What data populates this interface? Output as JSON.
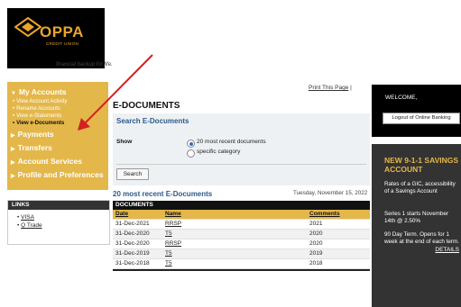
{
  "brand": {
    "name": "OPPA",
    "sub": "CREDIT UNION",
    "tagline": "financial backup for life."
  },
  "nav": {
    "my_accounts": "My Accounts",
    "sub_items": [
      "View Account Activity",
      "Rename Accounts",
      "View e-Statements",
      "View e-Documents"
    ],
    "payments": "Payments",
    "transfers": "Transfers",
    "account_services": "Account Services",
    "profile": "Profile and Preferences"
  },
  "links": {
    "title": "LINKS",
    "items": [
      "VISA",
      "Q Trade"
    ]
  },
  "main": {
    "print_link": "Print This Page",
    "title": "E-DOCUMENTS",
    "search_title": "Search E-Documents",
    "show_label": "Show",
    "option_recent": "20 most recent documents",
    "option_category": "specific category",
    "search_button": "Search",
    "recent_title": "20 most recent E-Documents",
    "date": "Tuesday, November 15, 2022"
  },
  "table": {
    "title": "DOCUMENTS",
    "headers": [
      "Date",
      "Name",
      "Comments"
    ],
    "rows": [
      [
        "31-Dec-2021",
        "RRSP",
        "2021"
      ],
      [
        "31-Dec-2020",
        "T5",
        "2020"
      ],
      [
        "31-Dec-2020",
        "RRSP",
        "2020"
      ],
      [
        "31-Dec-2019",
        "T5",
        "2019"
      ],
      [
        "31-Dec-2018",
        "T5",
        "2018"
      ]
    ]
  },
  "right": {
    "welcome": "WELCOME,",
    "logout": "Logout of Online Banking",
    "promo_title": "NEW 9-1-1 SAVINGS ACCOUNT",
    "promo_p1": "Rates of a GIC, accessibility of a Savings Account",
    "promo_p2": "Series 1 starts November 14th @ 2.50%",
    "promo_p3": "90 Day Term. Opens for 1 week at the end of each term.",
    "details": "DETAILS"
  },
  "colors": {
    "accent": "#e4b74a",
    "link_blue": "#2b5a8a",
    "arrow_red": "#d42020"
  }
}
